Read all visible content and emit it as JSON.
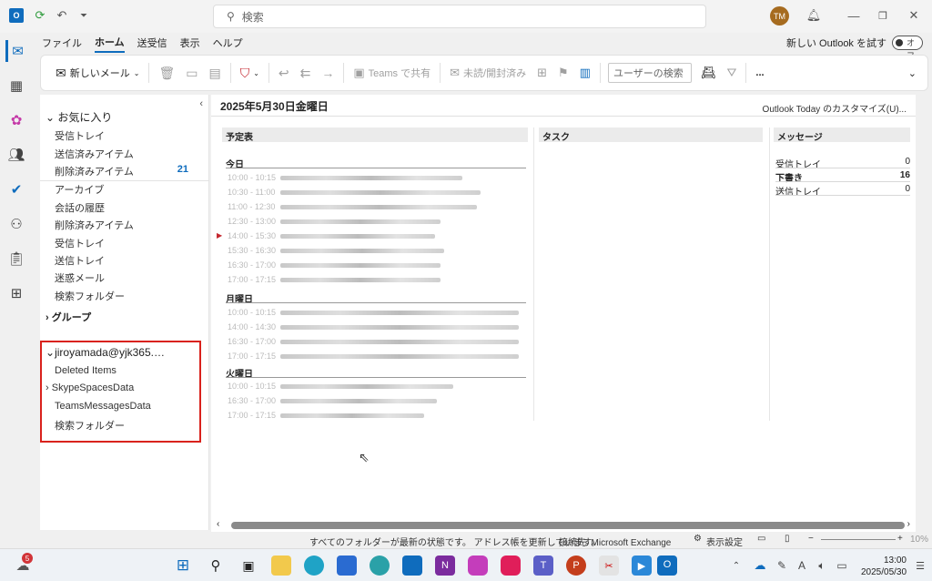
{
  "search": {
    "placeholder": "検索"
  },
  "user": {
    "initials": "TM"
  },
  "menu": {
    "tabs": [
      {
        "label": "ファイル"
      },
      {
        "label": "ホーム"
      },
      {
        "label": "送受信"
      },
      {
        "label": "表示"
      },
      {
        "label": "ヘルプ"
      }
    ],
    "new_outlook_label": "新しい Outlook を試す",
    "new_outlook_toggle": "オフ"
  },
  "ribbon": {
    "new_mail": "新しいメール",
    "teams_share": "Teams で共有",
    "unread_read": "未読/開封済み",
    "user_search_placeholder": "ユーザーの検索",
    "more": "..."
  },
  "folders": {
    "favorites_header": "お気に入り",
    "favorites": [
      {
        "label": "受信トレイ"
      },
      {
        "label": "送信済みアイテム"
      },
      {
        "label": "削除済みアイテム",
        "count": "21"
      }
    ],
    "other": [
      {
        "label": "アーカイブ"
      },
      {
        "label": "会話の履歴"
      },
      {
        "label": "削除済みアイテム"
      },
      {
        "label": "受信トレイ"
      },
      {
        "label": "送信トレイ"
      },
      {
        "label": "迷惑メール"
      },
      {
        "label": "検索フォルダー"
      }
    ],
    "groups_header": "グループ",
    "account_header": "jiroyamada@yjk365.…",
    "account_items": [
      {
        "label": "Deleted Items"
      },
      {
        "label": "SkypeSpacesData"
      },
      {
        "label": "TeamsMessagesData"
      },
      {
        "label": "検索フォルダー"
      }
    ]
  },
  "today": {
    "date_title": "2025年5月30日金曜日",
    "customize_link": "Outlook Today のカスタマイズ(U)...",
    "calendar_header": "予定表",
    "tasks_header": "タスク",
    "messages_header": "メッセージ",
    "days": [
      {
        "label": "今日",
        "times": [
          "10:00 - 10:15",
          "10:30 - 11:00",
          "11:00 - 12:30",
          "12:30 - 13:00",
          "14:00 - 15:30",
          "15:30 - 16:30",
          "16:30 - 17:00",
          "17:00 - 17:15"
        ]
      },
      {
        "label": "月曜日",
        "times": [
          "10:00 - 10:15",
          "14:00 - 14:30",
          "16:30 - 17:00",
          "17:00 - 17:15"
        ]
      },
      {
        "label": "火曜日",
        "times": [
          "10:00 - 10:15",
          "16:30 - 17:00",
          "17:00 - 17:15"
        ]
      }
    ],
    "messages": [
      {
        "label": "受信トレイ",
        "value": "0"
      },
      {
        "label": "下書き",
        "value": "16"
      },
      {
        "label": "送信トレイ",
        "value": "0"
      }
    ]
  },
  "status": {
    "sync_message": "すべてのフォルダーが最新の状態です。 アドレス帳を更新しています。",
    "connection": "接続先: Microsoft Exchange",
    "view_settings": "表示設定",
    "zoom": "10%"
  },
  "taskbar": {
    "weather_badge": "5",
    "time": "13:00",
    "date": "2025/05/30"
  }
}
